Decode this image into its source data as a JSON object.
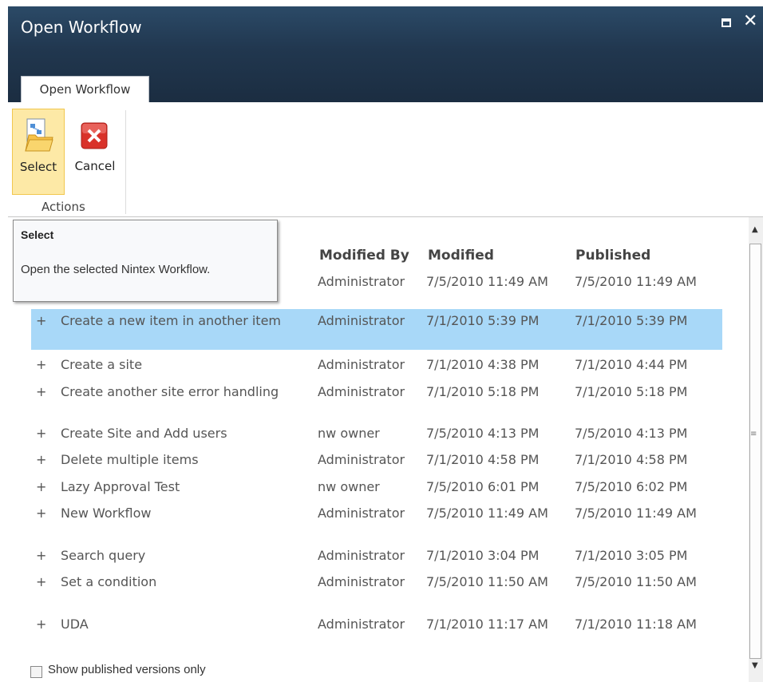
{
  "dialog": {
    "title": "Open Workflow"
  },
  "ribbon": {
    "tab": "Open Workflow",
    "buttons": {
      "select": "Select",
      "cancel": "Cancel"
    },
    "group_label": "Actions"
  },
  "tooltip": {
    "title": "Select",
    "body": "Open the selected Nintex Workflow."
  },
  "table": {
    "columns": {
      "modified_by": "Modified By",
      "modified": "Modified",
      "published": "Published"
    },
    "partial_row": {
      "modified_by": "Administrator",
      "modified": "7/5/2010 11:49 AM",
      "published": "7/5/2010 11:49 AM"
    },
    "rows": [
      {
        "expander": "+",
        "name": "Create a new item in another item",
        "modified_by": "Administrator",
        "modified": "7/1/2010 5:39 PM",
        "published": "7/1/2010 5:39 PM",
        "selected": true
      },
      {
        "expander": "+",
        "name": "Create a site",
        "modified_by": "Administrator",
        "modified": "7/1/2010 4:38 PM",
        "published": "7/1/2010 4:44 PM"
      },
      {
        "expander": "+",
        "name": "Create another site error handling",
        "modified_by": "Administrator",
        "modified": "7/1/2010 5:18 PM",
        "published": "7/1/2010 5:18 PM"
      },
      {
        "expander": "+",
        "name": "Create Site and Add users",
        "modified_by": "nw owner",
        "modified": "7/5/2010 4:13 PM",
        "published": "7/5/2010 4:13 PM"
      },
      {
        "expander": "+",
        "name": "Delete multiple items",
        "modified_by": "Administrator",
        "modified": "7/1/2010 4:58 PM",
        "published": "7/1/2010 4:58 PM"
      },
      {
        "expander": "+",
        "name": "Lazy Approval Test",
        "modified_by": "nw owner",
        "modified": "7/5/2010 6:01 PM",
        "published": "7/5/2010 6:02 PM"
      },
      {
        "expander": "+",
        "name": "New Workflow",
        "modified_by": "Administrator",
        "modified": "7/5/2010 11:49 AM",
        "published": "7/5/2010 11:49 AM"
      },
      {
        "expander": "+",
        "name": "Search query",
        "modified_by": "Administrator",
        "modified": "7/1/2010 3:04 PM",
        "published": "7/1/2010 3:05 PM"
      },
      {
        "expander": "+",
        "name": "Set a condition",
        "modified_by": "Administrator",
        "modified": "7/5/2010 11:50 AM",
        "published": "7/5/2010 11:50 AM"
      },
      {
        "expander": "+",
        "name": "UDA",
        "modified_by": "Administrator",
        "modified": "7/1/2010 11:17 AM",
        "published": "7/1/2010 11:18 AM"
      }
    ]
  },
  "filter": {
    "label": "Show published versions only",
    "checked": false
  },
  "icons": {
    "select": "open-workflow-icon",
    "cancel": "cancel-x-icon",
    "maximize": "maximize-icon",
    "close": "close-icon"
  },
  "colors": {
    "titlebar": "#21374f",
    "selected_row": "#a8d8f8",
    "select_button": "#fde9a6",
    "cancel_icon": "#d9322a"
  }
}
